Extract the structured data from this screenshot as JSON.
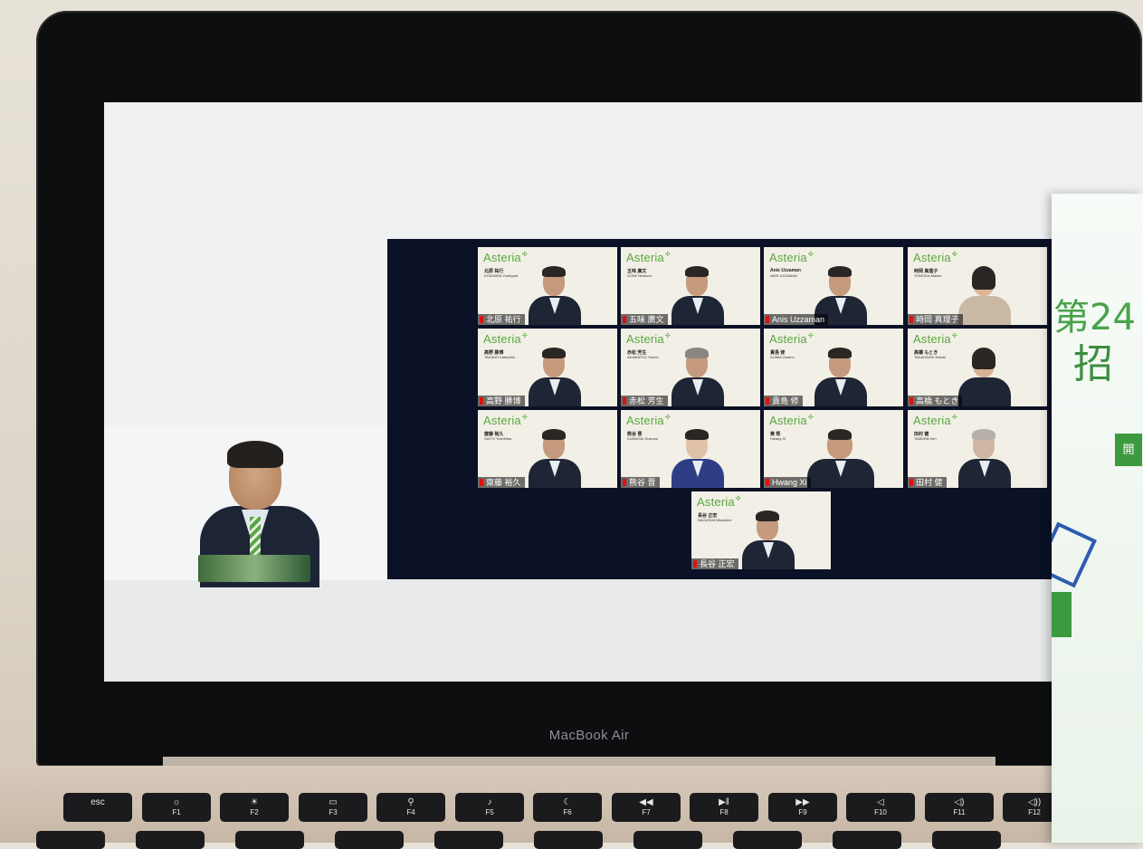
{
  "device": {
    "brand_label": "MacBook Air"
  },
  "conference": {
    "participants": [
      {
        "logo": "Asteria",
        "jp_name": "北原 祐行",
        "roman_name": "KITAHARA Yoshiyuki",
        "caption": "北原 祐行"
      },
      {
        "logo": "Asteria",
        "jp_name": "五味 廣文",
        "roman_name": "GOMI Hirofumi",
        "caption": "五味 廣文"
      },
      {
        "logo": "Asteria",
        "jp_name": "Anis Uzzaman",
        "roman_name": "ANIS UZZAMAN",
        "caption": "Anis Uzzaman"
      },
      {
        "logo": "Asteria",
        "jp_name": "時岡 真理子",
        "roman_name": "TOKIOKA Mariko",
        "caption": "時岡 真理子"
      },
      {
        "logo": "Asteria",
        "jp_name": "高野 勝博",
        "roman_name": "TAKANO Katsuhiro",
        "caption": "高野 勝博"
      },
      {
        "logo": "Asteria",
        "jp_name": "赤松 芳生",
        "roman_name": "AKAMATSU Yoshio",
        "caption": "赤松 芳生"
      },
      {
        "logo": "Asteria",
        "jp_name": "貴島 修",
        "roman_name": "KIJIMA Osamu",
        "caption": "貴島 修"
      },
      {
        "logo": "Asteria",
        "jp_name": "高橋 もとき",
        "roman_name": "TAKAHASHI Motoki",
        "caption": "高橋 もとき"
      },
      {
        "logo": "Asteria",
        "jp_name": "齋藤 裕久",
        "roman_name": "SAITO Yoshihisa",
        "caption": "齋藤 裕久"
      },
      {
        "logo": "Asteria",
        "jp_name": "熊谷 晋",
        "roman_name": "KUMAGAI Susumu",
        "caption": "熊谷 晋"
      },
      {
        "logo": "Asteria",
        "jp_name": "黄 熙",
        "roman_name": "Hwang Xi",
        "caption": "Hwang Xi"
      },
      {
        "logo": "Asteria",
        "jp_name": "田村 健",
        "roman_name": "TAMURA Ken",
        "caption": "田村 健"
      },
      {
        "logo": "Asteria",
        "jp_name": "長谷 正宏",
        "roman_name": "NAGATANI Masahiro",
        "caption": "長谷 正宏"
      }
    ]
  },
  "flyer": {
    "line1": "第24",
    "line2": "招",
    "tag": "開"
  },
  "keyboard": {
    "keys": [
      "esc",
      "F1",
      "F2",
      "F3",
      "F4",
      "F5",
      "F6",
      "F7",
      "F8",
      "F9",
      "F10",
      "F11",
      "F12"
    ]
  }
}
